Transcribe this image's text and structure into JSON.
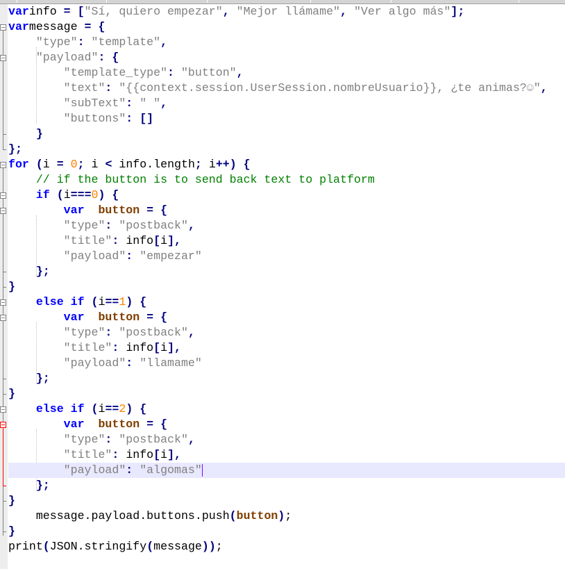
{
  "editor": {
    "language": "javascript",
    "current_line": 31,
    "colors": {
      "keyword": "#0000ff",
      "identifier": "#804000",
      "operator": "#000080",
      "string": "#808080",
      "number": "#ff8000",
      "comment": "#008000",
      "current_line_bg": "#e8e8ff",
      "active_fold": "#ff0000"
    },
    "lines": [
      {
        "n": 1,
        "t": [
          [
            "kw",
            "var"
          ],
          [
            "",
            "info "
          ],
          [
            "op",
            "= ["
          ],
          [
            "str",
            "\"Sí, quiero empezar\""
          ],
          [
            "op",
            ", "
          ],
          [
            "str",
            "\"Mejor llámame\""
          ],
          [
            "op",
            ", "
          ],
          [
            "str",
            "\"Ver algo más\""
          ],
          [
            "op",
            "];"
          ]
        ]
      },
      {
        "n": 2,
        "t": [
          [
            "kw",
            "var"
          ],
          [
            "",
            "message "
          ],
          [
            "op",
            "= {"
          ]
        ]
      },
      {
        "n": 3,
        "t": [
          [
            "",
            "    "
          ],
          [
            "str",
            "\"type\""
          ],
          [
            "op",
            ": "
          ],
          [
            "str",
            "\"template\""
          ],
          [
            "op",
            ","
          ]
        ]
      },
      {
        "n": 4,
        "t": [
          [
            "",
            "    "
          ],
          [
            "str",
            "\"payload\""
          ],
          [
            "op",
            ": {"
          ]
        ]
      },
      {
        "n": 5,
        "t": [
          [
            "",
            "        "
          ],
          [
            "str",
            "\"template_type\""
          ],
          [
            "op",
            ": "
          ],
          [
            "str",
            "\"button\""
          ],
          [
            "op",
            ","
          ]
        ]
      },
      {
        "n": 6,
        "t": [
          [
            "",
            "        "
          ],
          [
            "str",
            "\"text\""
          ],
          [
            "op",
            ": "
          ],
          [
            "str",
            "\"{{context.session.UserSession.nombreUsuario}}, ¿te animas?☺\""
          ],
          [
            "op",
            ","
          ]
        ]
      },
      {
        "n": 7,
        "t": [
          [
            "",
            "        "
          ],
          [
            "str",
            "\"subText\""
          ],
          [
            "op",
            ": "
          ],
          [
            "str",
            "\" \""
          ],
          [
            "op",
            ","
          ]
        ]
      },
      {
        "n": 8,
        "t": [
          [
            "",
            "        "
          ],
          [
            "str",
            "\"buttons\""
          ],
          [
            "op",
            ": []"
          ]
        ]
      },
      {
        "n": 9,
        "t": [
          [
            "",
            "    "
          ],
          [
            "op",
            "}"
          ]
        ]
      },
      {
        "n": 10,
        "t": [
          [
            "op",
            "};"
          ]
        ]
      },
      {
        "n": 11,
        "t": [
          [
            "kw",
            "for"
          ],
          [
            "op",
            " ("
          ],
          [
            "",
            "i "
          ],
          [
            "op",
            "= "
          ],
          [
            "num",
            "0"
          ],
          [
            "op",
            "; "
          ],
          [
            "",
            "i "
          ],
          [
            "op",
            "< "
          ],
          [
            "",
            "info.length"
          ],
          [
            "op",
            "; "
          ],
          [
            "",
            "i"
          ],
          [
            "op",
            "++) {"
          ]
        ]
      },
      {
        "n": 12,
        "t": [
          [
            "",
            "    "
          ],
          [
            "cmt",
            "// if the button is to send back text to platform"
          ]
        ]
      },
      {
        "n": 13,
        "t": [
          [
            "",
            "    "
          ],
          [
            "kw",
            "if"
          ],
          [
            "op",
            " ("
          ],
          [
            "",
            "i"
          ],
          [
            "op",
            "==="
          ],
          [
            "num",
            "0"
          ],
          [
            "op",
            ") {"
          ]
        ]
      },
      {
        "n": 14,
        "t": [
          [
            "",
            "        "
          ],
          [
            "kw",
            "var"
          ],
          [
            "",
            "  "
          ],
          [
            "id",
            "button"
          ],
          [
            "op",
            " = {"
          ]
        ]
      },
      {
        "n": 15,
        "t": [
          [
            "",
            "        "
          ],
          [
            "str",
            "\"type\""
          ],
          [
            "op",
            ": "
          ],
          [
            "str",
            "\"postback\""
          ],
          [
            "op",
            ","
          ]
        ]
      },
      {
        "n": 16,
        "t": [
          [
            "",
            "        "
          ],
          [
            "str",
            "\"title\""
          ],
          [
            "op",
            ": "
          ],
          [
            "",
            "info"
          ],
          [
            "op",
            "["
          ],
          [
            "",
            "i"
          ],
          [
            "op",
            "],"
          ]
        ]
      },
      {
        "n": 17,
        "t": [
          [
            "",
            "        "
          ],
          [
            "str",
            "\"payload\""
          ],
          [
            "op",
            ": "
          ],
          [
            "str",
            "\"empezar\""
          ]
        ]
      },
      {
        "n": 18,
        "t": [
          [
            "",
            "    "
          ],
          [
            "op",
            "};"
          ]
        ]
      },
      {
        "n": 19,
        "t": [
          [
            "op",
            "}"
          ]
        ]
      },
      {
        "n": 20,
        "t": [
          [
            "",
            "    "
          ],
          [
            "kw",
            "else if"
          ],
          [
            "op",
            " ("
          ],
          [
            "",
            "i"
          ],
          [
            "op",
            "=="
          ],
          [
            "num",
            "1"
          ],
          [
            "op",
            ") {"
          ]
        ]
      },
      {
        "n": 21,
        "t": [
          [
            "",
            "        "
          ],
          [
            "kw",
            "var"
          ],
          [
            "",
            "  "
          ],
          [
            "id",
            "button"
          ],
          [
            "op",
            " = {"
          ]
        ]
      },
      {
        "n": 22,
        "t": [
          [
            "",
            "        "
          ],
          [
            "str",
            "\"type\""
          ],
          [
            "op",
            ": "
          ],
          [
            "str",
            "\"postback\""
          ],
          [
            "op",
            ","
          ]
        ]
      },
      {
        "n": 23,
        "t": [
          [
            "",
            "        "
          ],
          [
            "str",
            "\"title\""
          ],
          [
            "op",
            ": "
          ],
          [
            "",
            "info"
          ],
          [
            "op",
            "["
          ],
          [
            "",
            "i"
          ],
          [
            "op",
            "],"
          ]
        ]
      },
      {
        "n": 24,
        "t": [
          [
            "",
            "        "
          ],
          [
            "str",
            "\"payload\""
          ],
          [
            "op",
            ": "
          ],
          [
            "str",
            "\"llamame\""
          ]
        ]
      },
      {
        "n": 25,
        "t": [
          [
            "",
            "    "
          ],
          [
            "op",
            "};"
          ]
        ]
      },
      {
        "n": 26,
        "t": [
          [
            "op",
            "}"
          ]
        ]
      },
      {
        "n": 27,
        "t": [
          [
            "",
            "    "
          ],
          [
            "kw",
            "else if"
          ],
          [
            "op",
            " ("
          ],
          [
            "",
            "i"
          ],
          [
            "op",
            "=="
          ],
          [
            "num",
            "2"
          ],
          [
            "op",
            ") {"
          ]
        ]
      },
      {
        "n": 28,
        "t": [
          [
            "",
            "        "
          ],
          [
            "kw",
            "var"
          ],
          [
            "",
            "  "
          ],
          [
            "id",
            "button"
          ],
          [
            "op",
            " = {"
          ]
        ]
      },
      {
        "n": 29,
        "t": [
          [
            "",
            "        "
          ],
          [
            "str",
            "\"type\""
          ],
          [
            "op",
            ": "
          ],
          [
            "str",
            "\"postback\""
          ],
          [
            "op",
            ","
          ]
        ]
      },
      {
        "n": 30,
        "t": [
          [
            "",
            "        "
          ],
          [
            "str",
            "\"title\""
          ],
          [
            "op",
            ": "
          ],
          [
            "",
            "info"
          ],
          [
            "op",
            "["
          ],
          [
            "",
            "i"
          ],
          [
            "op",
            "],"
          ]
        ]
      },
      {
        "n": 31,
        "t": [
          [
            "",
            "        "
          ],
          [
            "str",
            "\"payload\""
          ],
          [
            "op",
            ": "
          ],
          [
            "str",
            "\"algomas\""
          ]
        ]
      },
      {
        "n": 32,
        "t": [
          [
            "",
            "    "
          ],
          [
            "op",
            "};"
          ]
        ]
      },
      {
        "n": 33,
        "t": [
          [
            "op",
            "}"
          ]
        ]
      },
      {
        "n": 34,
        "t": [
          [
            "",
            "    message.payload.buttons.push"
          ],
          [
            "op",
            "("
          ],
          [
            "id",
            "button"
          ],
          [
            "op",
            ")"
          ],
          [
            "",
            ";"
          ]
        ]
      },
      {
        "n": 35,
        "t": [
          [
            "op",
            "}"
          ]
        ]
      },
      {
        "n": 36,
        "t": [
          [
            "",
            "print"
          ],
          [
            "op",
            "("
          ],
          [
            "",
            "JSON.stringify"
          ],
          [
            "op",
            "("
          ],
          [
            "",
            "message"
          ],
          [
            "op",
            "))"
          ],
          [
            "",
            ";"
          ]
        ]
      }
    ]
  }
}
